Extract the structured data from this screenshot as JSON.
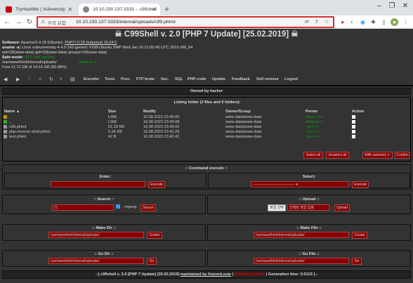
{
  "browser": {
    "tabs": [
      {
        "title": "TryHackMe | Vulnversity"
      },
      {
        "title": "10.10.230.137:3333 -- c99shell"
      }
    ],
    "omnibox": {
      "security_label": "주의 요함",
      "url": "10.10.230.137:3333/internal/uploads/c99.phtml"
    },
    "colors": {
      "omnibox_highlight": "#d32f2f"
    }
  },
  "shell": {
    "title": "C99Shell v. 2.0 [PHP 7 Update] [25.02.2019]",
    "info": {
      "software_label": "Software:",
      "software": "Apache/2.4.18 (Ubuntu).",
      "php": "PHP/7.0.33-0ubuntu0.16.04.5",
      "uname_label": "uname -a:",
      "uname": "Linux vulnuniversity 4.4.0-142-generic #168-Ubuntu SMP Wed Jan 16 21:00:45 UTC 2019 x86_64",
      "uid": "uid=33(www-data) gid=33(www-data) groups=33(www-data)",
      "safe_mode_label": "Safe-mode:",
      "safe_mode_value": "OFF (not secure)",
      "path": "/var/www/html/internal/uploads/",
      "path_status": "drwxr-xr-x",
      "free": "Free 11.72 GB of 14.14 GB (82.88%)"
    },
    "toolbar": {
      "icons": [
        "back-icon",
        "forward-icon",
        "up-icon",
        "home-icon",
        "refresh-icon",
        "search-icon",
        "buffer-icon"
      ],
      "links": [
        "Encoder",
        "Tools",
        "Proc.",
        "FTP brute",
        "Sec.",
        "SQL",
        "PHP-code",
        "Update",
        "Feedback",
        "Self remove",
        "Logout"
      ]
    },
    "owned_by": "Owned by hacker",
    "listing": {
      "title": "Listing folder (3 files and 0 folders):",
      "headers": {
        "name": "Name ▲",
        "size": "Size",
        "modify": "Modify",
        "owner": "Owner/Group",
        "perms": "Perms",
        "action": "Action"
      },
      "rows": [
        {
          "name": ".",
          "size": "LINK",
          "modify": "16.08.2023 23:49:00",
          "owner": "www-data/www-data",
          "perms": "drwxr-xr-x"
        },
        {
          "name": "..",
          "size": "LINK",
          "modify": "16.08.2023 23:49:08",
          "owner": "www-data/www-data",
          "perms": "drwxr-xr-x"
        },
        {
          "name": "c99.phtml",
          "size": "61.33 KB",
          "modify": "16.08.2023 23:49:00",
          "owner": "www-data/www-data",
          "perms": "-rw-r--r--"
        },
        {
          "name": "php-reverse-shell.phtml",
          "size": "5.36 KB",
          "modify": "16.08.2023 23:41:29",
          "owner": "www-data/www-data",
          "perms": "-rw-r--r--"
        },
        {
          "name": "test.phtml",
          "size": "42 B",
          "modify": "16.08.2023 23:42:42",
          "owner": "www-data/www-data",
          "perms": "-rw-r--r--"
        }
      ],
      "select_all": "Select all",
      "unselect_all": "Unselect all",
      "with_selected": "With selected:",
      "confirm": "Confirm"
    },
    "command": {
      "title": ":: Command execute ::",
      "enter_label": "Enter:",
      "select_label": "Select:",
      "select_value": "------------------------------------",
      "execute": "Execute"
    },
    "search": {
      "title": ":: Search ::",
      "value": "(*)",
      "regexp_label": "- regexp",
      "button": "Search"
    },
    "upload": {
      "title": ":: Upload ::",
      "choose": "파일 선택",
      "no_file": "선택된 파일 없음",
      "button": "Upload"
    },
    "make_dir": {
      "title": ":: Make Dir ::",
      "value": "/var/www/html/internal/uploads/",
      "button": "Create"
    },
    "make_file": {
      "title": ":: Make File ::",
      "value": "/var/www/html/internal/uploads/",
      "button": "Create"
    },
    "go_dir": {
      "title": ":: Go Dir ::",
      "value": "/var/www/html/internal/uploads/",
      "button": "Go"
    },
    "go_file": {
      "title": ":: Go File ::",
      "value": "/var/www/html/internal/uploads/",
      "button": "Go"
    },
    "footer": {
      "prefix": "--[ c99shell v. 2.0 [PHP 7 Update] [25.02.2019]",
      "maintained": "maintained by KaizenLouie",
      "mid": " | ",
      "link": "C99Shell Github",
      "suffix": " | Generation time: 0.0123 ]--"
    }
  }
}
